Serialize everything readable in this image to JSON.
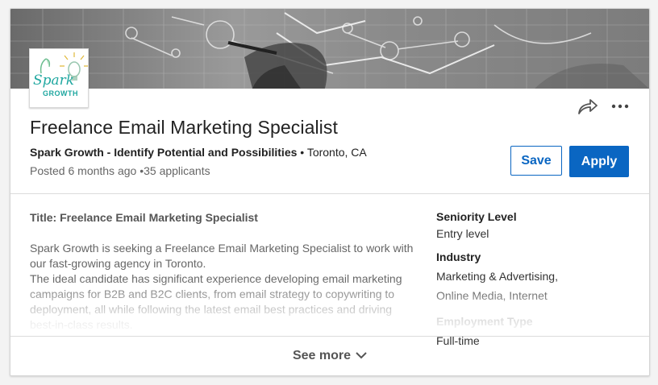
{
  "job": {
    "title": "Freelance Email Marketing Specialist",
    "company": "Spark Growth - Identify Potential and Possibilities",
    "location": "• Toronto, CA",
    "posted": "Posted 6 months ago •35 applicants"
  },
  "logo": {
    "text_top": "Spark",
    "text_bottom": "GROWTH",
    "colors": {
      "teal": "#1fa7a0",
      "accent": "#e0b93a"
    }
  },
  "actions": {
    "save_label": "Save",
    "apply_label": "Apply",
    "share_icon": "share-arrow-icon",
    "more_icon": "more-dots-icon"
  },
  "description": {
    "heading": "Title: Freelance Email Marketing Specialist",
    "paragraph1": "Spark Growth is seeking a Freelance Email Marketing Specialist to work with our fast-growing agency in Toronto.",
    "paragraph2": "The ideal candidate has significant experience developing email marketing campaigns for B2B and B2C clients, from email strategy to copywriting to deployment, all while following the latest email best practices and driving best-in-class results."
  },
  "criteria": {
    "seniority_label": "Seniority Level",
    "seniority_value": "Entry level",
    "industry_label": "Industry",
    "industry_value_1": "Marketing & Advertising,",
    "industry_value_2": "Online Media, Internet",
    "employment_label": "Employment Type",
    "employment_value": "Full-time"
  },
  "footer": {
    "see_more_label": "See more"
  },
  "colors": {
    "primary": "#0a66c2",
    "text": "#222222",
    "muted": "#666666"
  }
}
